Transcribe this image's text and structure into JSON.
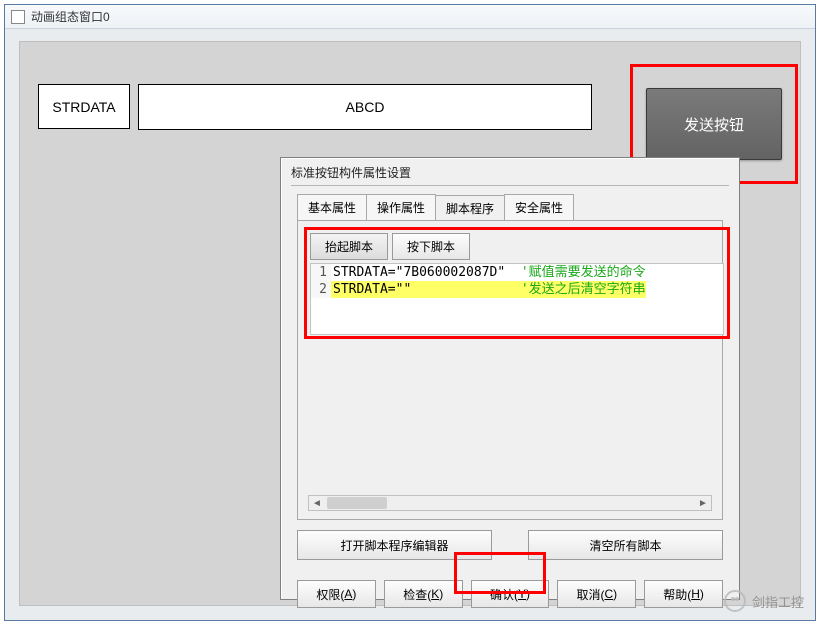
{
  "window": {
    "title": "动画组态窗口0"
  },
  "top": {
    "strdata_label": "STRDATA",
    "abcd_label": "ABCD",
    "send_button_label": "发送按钮"
  },
  "dialog": {
    "title": "标准按钮构件属性设置",
    "tabs": [
      "基本属性",
      "操作属性",
      "脚本程序",
      "安全属性"
    ],
    "active_tab_index": 2,
    "subtabs": [
      "抬起脚本",
      "按下脚本"
    ],
    "active_subtab_index": 0,
    "code_lines": [
      {
        "n": "1",
        "code": "STRDATA=\"7B060002087D\"",
        "comment": "'赋值需要发送的命令",
        "highlight": false
      },
      {
        "n": "2",
        "code": "STRDATA=\"\"",
        "comment": "'发送之后清空字符串",
        "highlight": true
      }
    ],
    "open_editor_label": "打开脚本程序编辑器",
    "clear_all_label": "清空所有脚本",
    "buttons": {
      "perm": {
        "label": "权限(",
        "key": "A",
        "suffix": ")"
      },
      "check": {
        "label": "检查(",
        "key": "K",
        "suffix": ")"
      },
      "ok": {
        "label": "确认(",
        "key": "Y",
        "suffix": ")"
      },
      "cancel": {
        "label": "取消(",
        "key": "C",
        "suffix": ")"
      },
      "help": {
        "label": "帮助(",
        "key": "H",
        "suffix": ")"
      }
    }
  },
  "watermark": "剑指工控"
}
